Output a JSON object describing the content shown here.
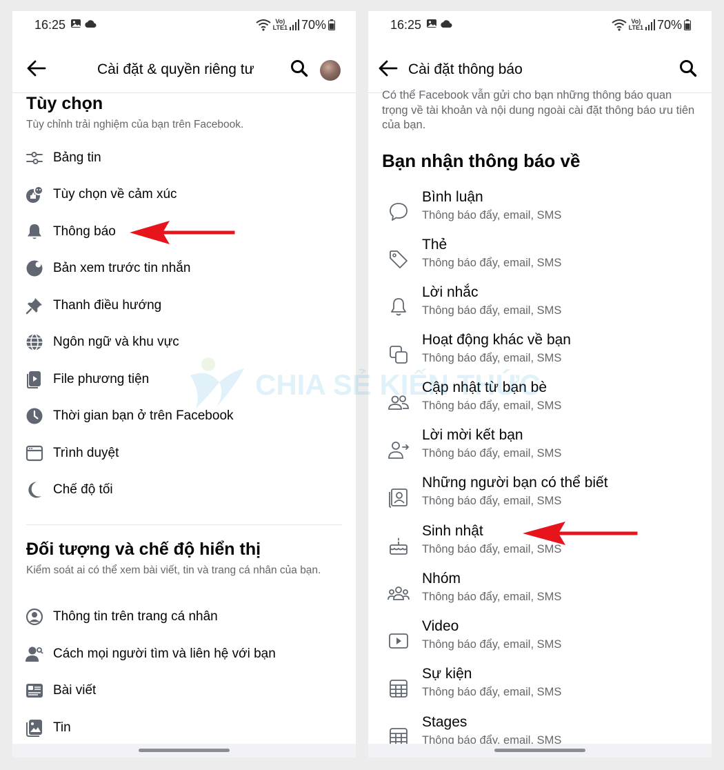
{
  "left": {
    "status": {
      "time": "16:25",
      "battery": "70%",
      "lte": "LTE1"
    },
    "title": "Cài đặt & quyền riêng tư",
    "section1": {
      "title": "Tùy chọn",
      "subtitle": "Tùy chỉnh trải nghiệm của bạn trên Facebook.",
      "items": [
        {
          "label": "Bảng tin",
          "icon": "sliders-icon"
        },
        {
          "label": "Tùy chọn về cảm xúc",
          "icon": "reactions-icon"
        },
        {
          "label": "Thông báo",
          "icon": "bell-icon"
        },
        {
          "label": "Bản xem trước tin nhắn",
          "icon": "message-preview-icon"
        },
        {
          "label": "Thanh điều hướng",
          "icon": "pin-icon"
        },
        {
          "label": "Ngôn ngữ và khu vực",
          "icon": "globe-icon"
        },
        {
          "label": "File phương tiện",
          "icon": "media-file-icon"
        },
        {
          "label": "Thời gian bạn ở trên Facebook",
          "icon": "clock-icon"
        },
        {
          "label": "Trình duyệt",
          "icon": "browser-icon"
        },
        {
          "label": "Chế độ tối",
          "icon": "moon-icon"
        }
      ]
    },
    "section2": {
      "title": "Đối tượng và chế độ hiển thị",
      "subtitle": "Kiểm soát ai có thể xem bài viết, tin và trang cá nhân của bạn.",
      "items": [
        {
          "label": "Thông tin trên trang cá nhân",
          "icon": "profile-icon"
        },
        {
          "label": "Cách mọi người tìm và liên hệ với bạn",
          "icon": "find-people-icon"
        },
        {
          "label": "Bài viết",
          "icon": "post-icon"
        },
        {
          "label": "Tin",
          "icon": "stories-icon"
        }
      ]
    }
  },
  "right": {
    "status": {
      "time": "16:25",
      "battery": "70%",
      "lte": "LTE1"
    },
    "title": "Cài đặt thông báo",
    "notice": "Có thể Facebook vẫn gửi cho bạn những thông báo quan trọng về tài khoản và nội dung ngoài cài đặt thông báo ưu tiên của bạn.",
    "section_title": "Bạn nhận thông báo về",
    "items": [
      {
        "title": "Bình luận",
        "sub": "Thông báo đẩy, email, SMS",
        "icon": "comment-icon"
      },
      {
        "title": "Thẻ",
        "sub": "Thông báo đẩy, email, SMS",
        "icon": "tag-icon"
      },
      {
        "title": "Lời nhắc",
        "sub": "Thông báo đẩy, email, SMS",
        "icon": "bell-icon"
      },
      {
        "title": "Hoạt động khác về bạn",
        "sub": "Thông báo đẩy, email, SMS",
        "icon": "layers-icon"
      },
      {
        "title": "Cập nhật từ bạn bè",
        "sub": "Thông báo đẩy, email, SMS",
        "icon": "friends-icon"
      },
      {
        "title": "Lời mời kết bạn",
        "sub": "Thông báo đẩy, email, SMS",
        "icon": "friend-request-icon"
      },
      {
        "title": "Những người bạn có thể biết",
        "sub": "Thông báo đẩy, email, SMS",
        "icon": "contact-card-icon"
      },
      {
        "title": "Sinh nhật",
        "sub": "Thông báo đẩy, email, SMS",
        "icon": "cake-icon"
      },
      {
        "title": "Nhóm",
        "sub": "Thông báo đẩy, email, SMS",
        "icon": "groups-icon"
      },
      {
        "title": "Video",
        "sub": "Thông báo đẩy, email, SMS",
        "icon": "video-icon"
      },
      {
        "title": "Sự kiện",
        "sub": "Thông báo đẩy, email, SMS",
        "icon": "calendar-icon"
      },
      {
        "title": "Stages",
        "sub": "Thông báo đẩy, email, SMS",
        "icon": "stages-icon"
      }
    ]
  },
  "watermark": "CHIA SẺ KIẾN THỨC",
  "colors": {
    "annotation_arrow": "#e8141b",
    "icon": "#606770",
    "secondary_text": "#65676b"
  }
}
